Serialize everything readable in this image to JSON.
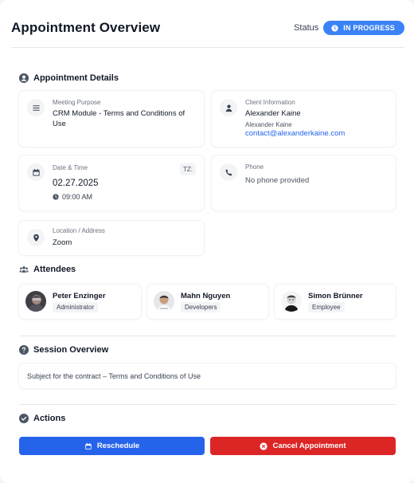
{
  "header": {
    "title": "Appointment Overview",
    "status_label": "Status",
    "status_value": "IN PROGRESS",
    "status_color": "#3b82f6"
  },
  "details": {
    "section_title": "Appointment Details",
    "meeting_purpose": {
      "label": "Meeting Purpose",
      "value": "CRM Module - Terms and Conditions of Use",
      "icon": "list-icon"
    },
    "client_information": {
      "label": "Client Information",
      "name": "Alexander Kaine",
      "sub_name": "Alexander Kaine",
      "email": "contact@alexanderkaine.com",
      "icon": "user-icon"
    },
    "date_time": {
      "label": "Date & Time",
      "date": "02.27.2025",
      "time": "09:00 AM",
      "tz_badge": "TZ:",
      "icon": "calendar-icon"
    },
    "phone": {
      "label": "Phone",
      "value": "No phone provided",
      "icon": "phone-icon"
    },
    "location": {
      "label": "Location / Address",
      "value": "Zoom",
      "icon": "map-pin-icon"
    }
  },
  "attendees": {
    "section_title": "Attendees",
    "items": [
      {
        "name": "Peter Enzinger",
        "role": "Administrator"
      },
      {
        "name": "Mahn Nguyen",
        "role": "Developers"
      },
      {
        "name": "Simon Brünner",
        "role": "Employee"
      }
    ]
  },
  "session": {
    "section_title": "Session Overview",
    "text": "Subject for the contract – Terms and Conditions of Use"
  },
  "actions": {
    "section_title": "Actions",
    "reschedule_label": "Reschedule",
    "reschedule_color": "#2563eb",
    "cancel_label": "Cancel Appointment",
    "cancel_color": "#dc2626"
  }
}
